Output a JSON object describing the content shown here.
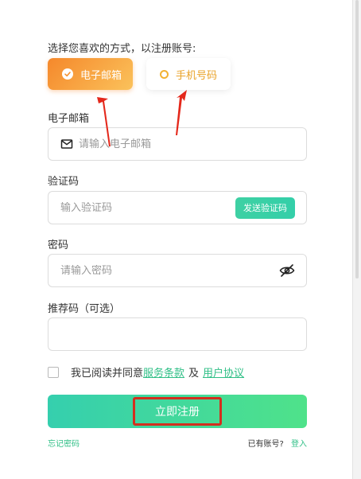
{
  "intro": "选择您喜欢的方式，以注册账号:",
  "methods": {
    "email": "电子邮箱",
    "phone": "手机号码"
  },
  "email": {
    "label": "电子邮箱",
    "placeholder": "请输入电子邮箱",
    "value": ""
  },
  "code": {
    "label": "验证码",
    "placeholder": "输入验证码",
    "value": "",
    "send_label": "发送验证码"
  },
  "password": {
    "label": "密码",
    "placeholder": "请输入密码",
    "value": ""
  },
  "referral": {
    "label": "推荐码（可选）",
    "placeholder": "",
    "value": ""
  },
  "agreement": {
    "prefix": "我已阅读并同意",
    "terms": "服务条款",
    "and": "及",
    "user_agreement": "用户协议"
  },
  "submit_label": "立即注册",
  "footer": {
    "forgot": "忘记密码",
    "have_account": "已有账号?",
    "login": "登入"
  },
  "colors": {
    "email_gradient_start": "#f5882b",
    "email_gradient_end": "#fbc25b",
    "phone_text": "#e9a227",
    "accent_green": "#2fbf86",
    "annotation_red": "#d32e1e"
  },
  "icons": {
    "email_method": "check-circle-icon",
    "phone_method": "radio-ring-icon",
    "email_field": "mail-icon",
    "password_toggle": "eye-off-icon"
  }
}
